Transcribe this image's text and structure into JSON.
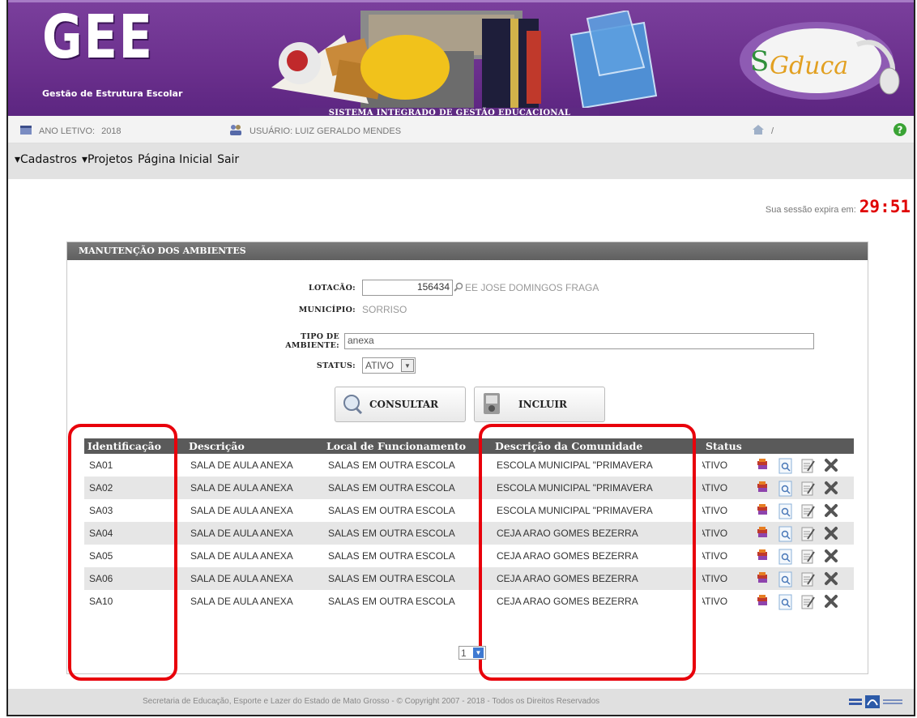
{
  "header": {
    "logo_text": "GEE",
    "logo_subtitle": "Gestão de Estrutura Escolar",
    "system_title": "SISTEMA INTEGRADO DE GESTÃO EDUCACIONAL",
    "partner_logo_text": "SiGEduca"
  },
  "infobar": {
    "year_label": "ANO LETIVO:",
    "year_value": "2018",
    "user_label": "USUÁRIO: LUIZ GERALDO MENDES",
    "home_sep": "/"
  },
  "menu": {
    "cadastros": "Cadastros",
    "projetos": "Projetos",
    "inicial": "Página Inicial",
    "sair": "Sair"
  },
  "session": {
    "label": "Sua sessão expira em:",
    "time": "29:51"
  },
  "panel": {
    "title": "MANUTENÇÃO DOS AMBIENTES",
    "lotacao_label": "LOTACÃO:",
    "lotacao_code": "156434",
    "lotacao_name": "EE JOSE DOMINGOS FRAGA",
    "municipio_label": "MUNICÍPIO:",
    "municipio_value": "SORRISO",
    "tipo_label": "TIPO DE AMBIENTE:",
    "tipo_value": "anexa",
    "status_label": "STATUS:",
    "status_value": "ATIVO",
    "consultar": "CONSULTAR",
    "incluir": "INCLUIR"
  },
  "table": {
    "headers": [
      "Identificação",
      "Descrição",
      "Local de Funcionamento",
      "Descrição da Comunidade",
      "Status"
    ],
    "rows": [
      [
        "SA01",
        "SALA DE AULA ANEXA",
        "SALAS EM OUTRA ESCOLA",
        "ESCOLA MUNICIPAL \"PRIMAVERA",
        "ATIVO"
      ],
      [
        "SA02",
        "SALA DE AULA ANEXA",
        "SALAS EM OUTRA ESCOLA",
        "ESCOLA MUNICIPAL \"PRIMAVERA",
        "ATIVO"
      ],
      [
        "SA03",
        "SALA DE AULA ANEXA",
        "SALAS EM OUTRA ESCOLA",
        "ESCOLA MUNICIPAL \"PRIMAVERA",
        "ATIVO"
      ],
      [
        "SA04",
        "SALA DE AULA ANEXA",
        "SALAS EM OUTRA ESCOLA",
        "CEJA ARAO GOMES BEZERRA",
        "ATIVO"
      ],
      [
        "SA05",
        "SALA DE AULA ANEXA",
        "SALAS EM OUTRA ESCOLA",
        "CEJA ARAO GOMES BEZERRA",
        "ATIVO"
      ],
      [
        "SA06",
        "SALA DE AULA ANEXA",
        "SALAS EM OUTRA ESCOLA",
        "CEJA ARAO GOMES BEZERRA",
        "ATIVO"
      ],
      [
        "SA10",
        "SALA DE AULA ANEXA",
        "SALAS EM OUTRA ESCOLA",
        "CEJA ARAO GOMES BEZERRA",
        "ATIVO"
      ]
    ]
  },
  "pager": {
    "page": "1"
  },
  "footer": {
    "text": "Secretaria de Educação, Esporte e Lazer do Estado de Mato Grosso - © Copyright 2007 - 2018 - Todos os Direitos Reservados"
  },
  "colors": {
    "banner": "#6a2f8c",
    "highlight": "#e8000b",
    "table_header": "#5a5a5a",
    "timer": "#e00000"
  },
  "icons": [
    "calendar-icon",
    "users-icon",
    "home-icon",
    "help-icon",
    "books-icon",
    "view-icon",
    "edit-icon",
    "delete-icon",
    "search-icon",
    "add-icon"
  ]
}
